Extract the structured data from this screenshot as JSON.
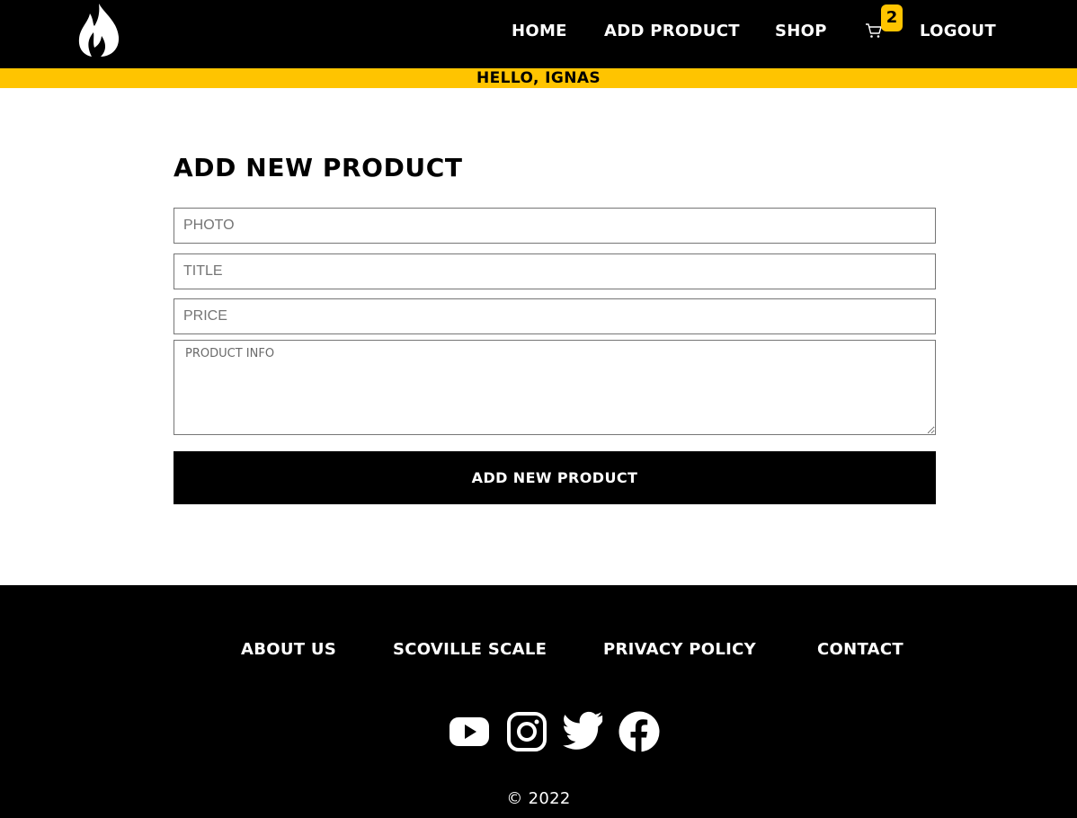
{
  "header": {
    "logo_icon": "flame-icon",
    "nav": {
      "home": "HOME",
      "add_product": "ADD PRODUCT",
      "shop": "SHOP",
      "logout": "LOGOUT"
    },
    "cart": {
      "icon": "cart-icon",
      "count": "2"
    }
  },
  "greeting": "HELLO, IGNAS",
  "form": {
    "title": "ADD NEW PRODUCT",
    "photo": {
      "placeholder": "PHOTO",
      "value": ""
    },
    "title_field": {
      "placeholder": "TITLE",
      "value": ""
    },
    "price": {
      "placeholder": "PRICE",
      "value": ""
    },
    "info": {
      "placeholder": "PRODUCT INFO",
      "value": ""
    },
    "submit_label": "ADD NEW PRODUCT"
  },
  "footer": {
    "links": {
      "about": "ABOUT US",
      "scoville": "SCOVILLE SCALE",
      "privacy": "PRIVACY POLICY",
      "contact": "CONTACT"
    },
    "social_icons": [
      "youtube-icon",
      "instagram-icon",
      "twitter-icon",
      "facebook-icon"
    ],
    "copyright": "© 2022"
  },
  "colors": {
    "accent": "#ffc400",
    "header_bg": "#000000",
    "page_bg": "#ffffff"
  }
}
